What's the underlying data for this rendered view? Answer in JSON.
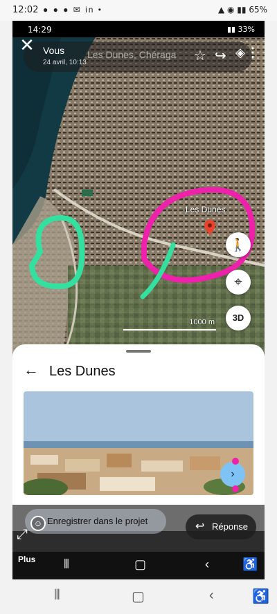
{
  "outer_status": {
    "time": "12:02",
    "app_icons": "● ● ● ✉ in •",
    "battery": "65%"
  },
  "inner_status": {
    "time": "14:29",
    "battery": "33%"
  },
  "header": {
    "user": "Vous",
    "date": "24 avril, 10:13",
    "place": "Les Dunes, Chéraga"
  },
  "map": {
    "place_label": "Les Dunes",
    "scale": "1000 m",
    "three_d_label": "3D",
    "annotation_colors": [
      "#ee22aa",
      "#33e0a0"
    ]
  },
  "sheet": {
    "title": "Les Dunes"
  },
  "actions": {
    "save_label": "Enregistrer dans le projet",
    "reply_label": "Réponse",
    "more_label": "Plus"
  },
  "icons": [
    "close-icon",
    "star-icon",
    "share-icon",
    "layers-icon",
    "more-vert-icon",
    "pin-icon",
    "pegman-icon",
    "locate-icon",
    "back-arrow-icon",
    "chevron-right-icon",
    "emoji-icon",
    "expand-icon",
    "reply-icon"
  ]
}
